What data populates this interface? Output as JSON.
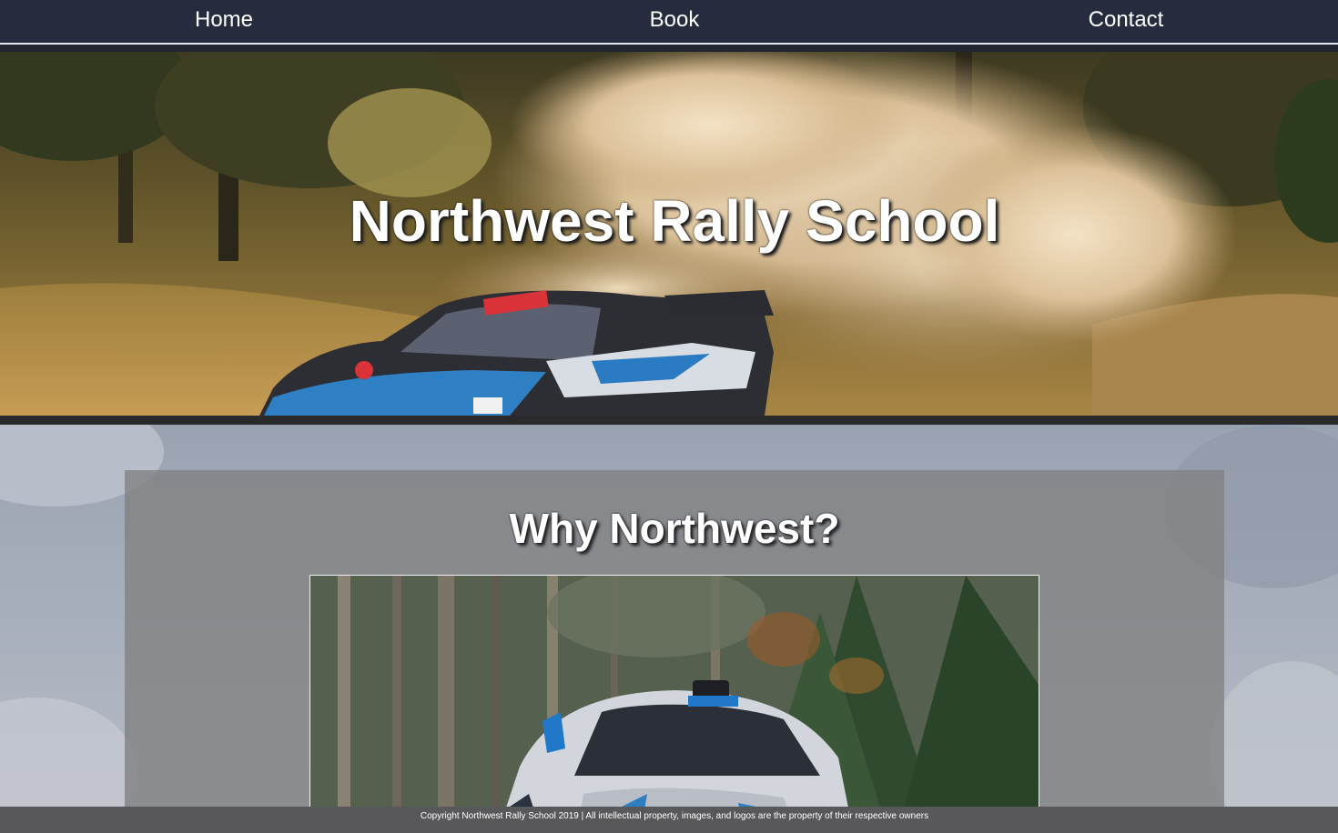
{
  "nav": {
    "items": [
      {
        "label": "Home"
      },
      {
        "label": "Book"
      },
      {
        "label": "Contact"
      }
    ]
  },
  "hero": {
    "title": "Northwest Rally School",
    "image_icon": "rally-car-dust-photo"
  },
  "section": {
    "title": "Why Northwest?",
    "image_icon": "rally-car-forest-photo"
  },
  "footer": {
    "text": "Copyright Northwest Rally School 2019 | All intellectual property, images, and logos are the property of their respective owners"
  },
  "colors": {
    "nav_bg": "#262c3d",
    "nav_text": "#ffffff",
    "footer_bg": "#58585a",
    "content_box": "#808082"
  }
}
